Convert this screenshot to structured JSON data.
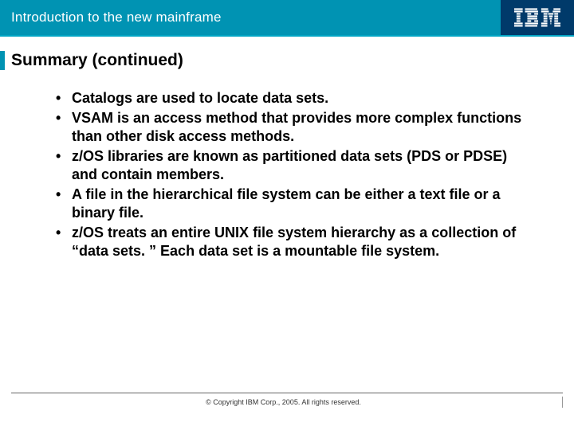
{
  "header": {
    "title": "Introduction to the new mainframe",
    "logo_name": "IBM"
  },
  "subhead": "Summary (continued)",
  "bullets": [
    "Catalogs are used to locate data sets.",
    "VSAM is an access method that provides more complex functions than other disk access methods.",
    "z/OS libraries are known as partitioned data sets (PDS or PDSE) and contain members.",
    "A file in the hierarchical file system can be either a text file or a binary file.",
    "z/OS treats an entire UNIX file system hierarchy as a collection of “data sets. ” Each data set is a mountable file system."
  ],
  "footer": {
    "copyright": "© Copyright IBM Corp., 2005. All rights reserved."
  },
  "colors": {
    "accent": "#0093b3",
    "logo_bg": "#003a6a"
  }
}
